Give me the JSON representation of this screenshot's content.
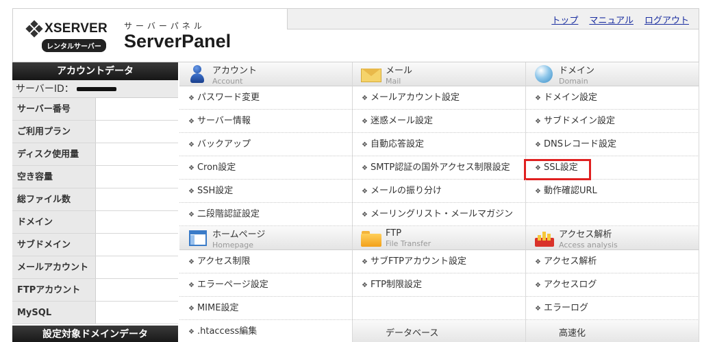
{
  "header": {
    "logo_main": "XSERVER",
    "logo_sub": "レンタルサーバー",
    "panel_kana": "サーバーパネル",
    "panel_title": "ServerPanel",
    "links": {
      "top": "トップ",
      "manual": "マニュアル",
      "logout": "ログアウト"
    }
  },
  "sidebar": {
    "title": "アカウントデータ",
    "server_id_label": "サーバーID：",
    "rows": [
      "サーバー番号",
      "ご利用プラン",
      "ディスク使用量",
      "空き容量",
      "総ファイル数",
      "ドメイン",
      "サブドメイン",
      "メールアカウント",
      "FTPアカウント",
      "MySQL"
    ],
    "footer_title": "設定対象ドメインデータ"
  },
  "menu": {
    "sections_top": [
      {
        "jp": "アカウント",
        "en": "Account",
        "icon": "account-icon"
      },
      {
        "jp": "メール",
        "en": "Mail",
        "icon": "mail-icon"
      },
      {
        "jp": "ドメイン",
        "en": "Domain",
        "icon": "globe-icon"
      }
    ],
    "account_items": [
      "パスワード変更",
      "サーバー情報",
      "バックアップ",
      "Cron設定",
      "SSH設定",
      "二段階認証設定"
    ],
    "mail_items": [
      "メールアカウント設定",
      "迷惑メール設定",
      "自動応答設定",
      "SMTP認証の国外アクセス制限設定",
      "メールの振り分け",
      "メーリングリスト・メールマガジン"
    ],
    "domain_items": [
      "ドメイン設定",
      "サブドメイン設定",
      "DNSレコード設定",
      "SSL設定",
      "動作確認URL"
    ],
    "sections_mid": [
      {
        "jp": "ホームページ",
        "en": "Homepage",
        "icon": "homepage-icon"
      },
      {
        "jp": "FTP",
        "en": "File Transfer",
        "icon": "folder-icon"
      },
      {
        "jp": "アクセス解析",
        "en": "Access analysis",
        "icon": "chart-icon"
      }
    ],
    "homepage_items": [
      "アクセス制限",
      "エラーページ設定",
      "MIME設定",
      ".htaccess編集"
    ],
    "ftp_items": [
      "サブFTPアカウント設定",
      "FTP制限設定"
    ],
    "analysis_items": [
      "アクセス解析",
      "アクセスログ",
      "エラーログ"
    ],
    "sections_bottom": [
      {
        "jp": "データベース"
      },
      {
        "jp": "高速化"
      }
    ],
    "highlight_color": "#e02020"
  }
}
